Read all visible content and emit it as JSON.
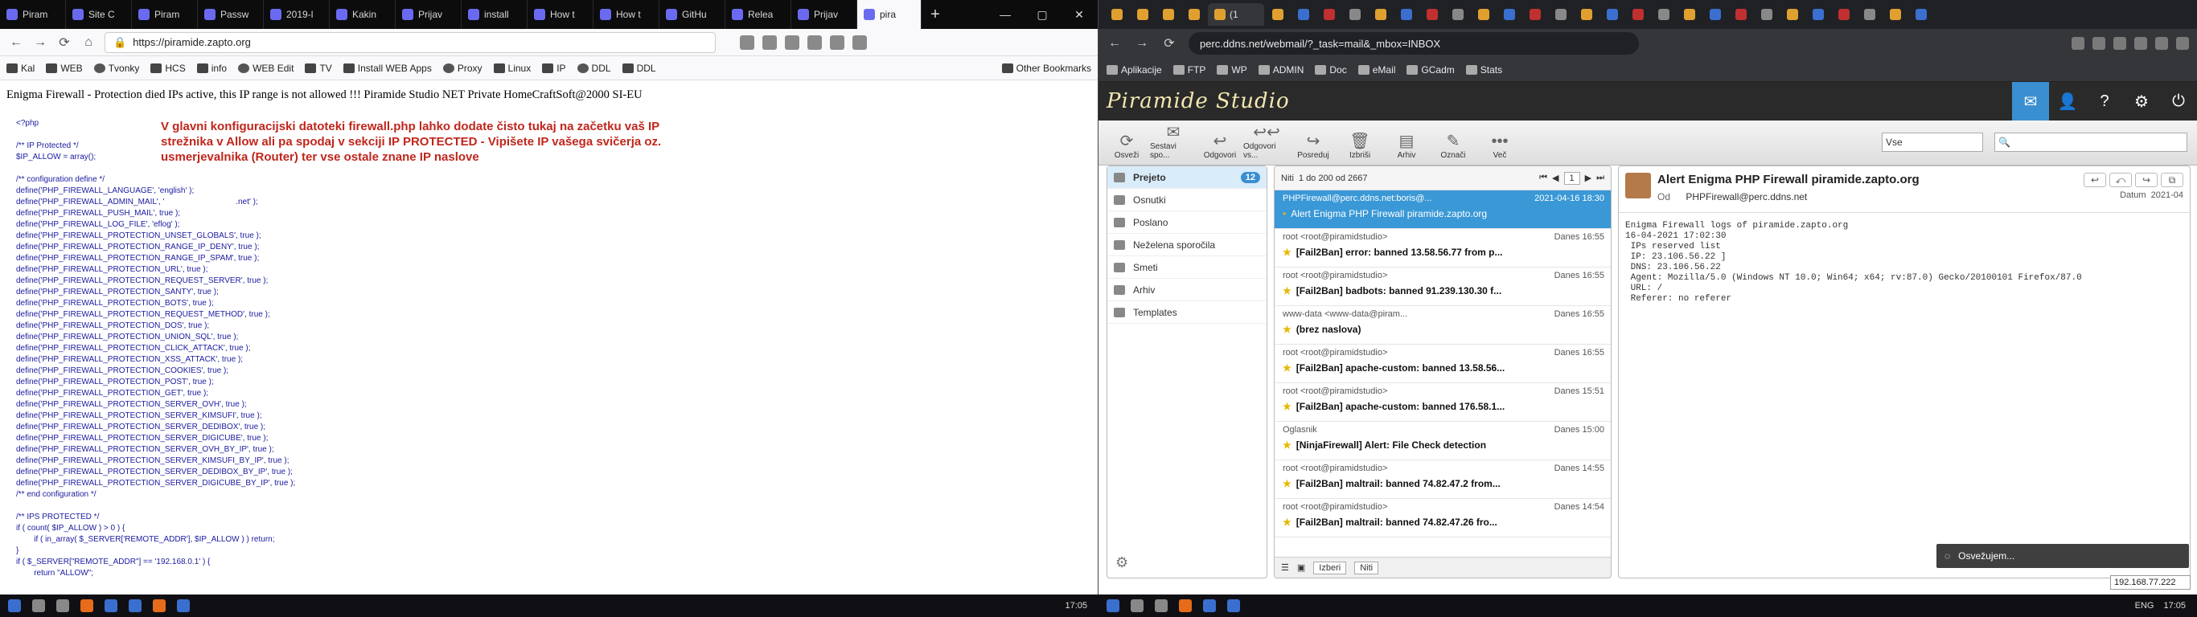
{
  "firefox": {
    "tabs": [
      "Piram",
      "Site C",
      "Piram",
      "Passw",
      "2019-l",
      "Kakin",
      "Prijav",
      "install",
      "How t",
      "How t",
      "GitHu",
      "Relea",
      "Prijav",
      "pira"
    ],
    "url": "https://piramide.zapto.org",
    "bookmarks": [
      "Kal",
      "WEB",
      "Tvonky",
      "HCS",
      "info",
      "WEB Edit",
      "TV",
      "Install WEB Apps",
      "Proxy",
      "Linux",
      "IP",
      "DDL",
      "DDL",
      "Other Bookmarks"
    ],
    "page": {
      "headline": "Enigma Firewall - Protection died IPs active, this IP range is not allowed !!! Piramide Studio NET Private HomeCraftSoft@2000 SI-EU",
      "notice": "V glavni konfiguracijski datoteki firewall.php lahko dodate čisto tukaj na začetku vaš IP strežnika v Allow ali pa spodaj v sekciji IP PROTECTED - Vipišete IP vašega svičerja oz. usmerjevalnika (Router) ter vse ostale znane IP naslove",
      "code": "<?php\n\n/** IP Protected */\n$IP_ALLOW = array();\n\n/** configuration define */\ndefine('PHP_FIREWALL_LANGUAGE', 'english' );\ndefine('PHP_FIREWALL_ADMIN_MAIL', '                                .net' );\ndefine('PHP_FIREWALL_PUSH_MAIL', true );\ndefine('PHP_FIREWALL_LOG_FILE', 'eflog' );\ndefine('PHP_FIREWALL_PROTECTION_UNSET_GLOBALS', true );\ndefine('PHP_FIREWALL_PROTECTION_RANGE_IP_DENY', true );\ndefine('PHP_FIREWALL_PROTECTION_RANGE_IP_SPAM', true );\ndefine('PHP_FIREWALL_PROTECTION_URL', true );\ndefine('PHP_FIREWALL_PROTECTION_REQUEST_SERVER', true );\ndefine('PHP_FIREWALL_PROTECTION_SANTY', true );\ndefine('PHP_FIREWALL_PROTECTION_BOTS', true );\ndefine('PHP_FIREWALL_PROTECTION_REQUEST_METHOD', true );\ndefine('PHP_FIREWALL_PROTECTION_DOS', true );\ndefine('PHP_FIREWALL_PROTECTION_UNION_SQL', true );\ndefine('PHP_FIREWALL_PROTECTION_CLICK_ATTACK', true );\ndefine('PHP_FIREWALL_PROTECTION_XSS_ATTACK', true );\ndefine('PHP_FIREWALL_PROTECTION_COOKIES', true );\ndefine('PHP_FIREWALL_PROTECTION_POST', true );\ndefine('PHP_FIREWALL_PROTECTION_GET', true );\ndefine('PHP_FIREWALL_PROTECTION_SERVER_OVH', true );\ndefine('PHP_FIREWALL_PROTECTION_SERVER_KIMSUFI', true );\ndefine('PHP_FIREWALL_PROTECTION_SERVER_DEDIBOX', true );\ndefine('PHP_FIREWALL_PROTECTION_SERVER_DIGICUBE', true );\ndefine('PHP_FIREWALL_PROTECTION_SERVER_OVH_BY_IP', true );\ndefine('PHP_FIREWALL_PROTECTION_SERVER_KIMSUFI_BY_IP', true );\ndefine('PHP_FIREWALL_PROTECTION_SERVER_DEDIBOX_BY_IP', true );\ndefine('PHP_FIREWALL_PROTECTION_SERVER_DIGICUBE_BY_IP', true );\n/** end configuration */\n\n/** IPS PROTECTED */\nif ( count( $IP_ALLOW ) > 0 ) {\n        if ( in_array( $_SERVER['REMOTE_ADDR'], $IP_ALLOW ) ) return;\n}\nif ( $_SERVER[\"REMOTE_ADDR\"] == '192.168.0.1' ) {\n        return \"ALLOW\";"
    }
  },
  "chrome": {
    "active_tab": "(1",
    "url": "perc.ddns.net/webmail/?_task=mail&_mbox=INBOX",
    "bookmarks": [
      "Aplikacije",
      "FTP",
      "WP",
      "ADMIN",
      "Doc",
      "eMail",
      "GCadm",
      "Stats"
    ],
    "logo": "Piramide Studio",
    "toolbar": [
      "Osveži",
      "Sestavi spo...",
      "Odgovori",
      "Odgovori vs...",
      "Posreduj",
      "Izbriši",
      "Arhiv",
      "Označi",
      "Več"
    ],
    "filter": "Vse",
    "folders": [
      {
        "name": "Prejeto",
        "count": "12",
        "selected": true
      },
      {
        "name": "Osnutki"
      },
      {
        "name": "Poslano"
      },
      {
        "name": "Neželena sporočila"
      },
      {
        "name": "Smeti"
      },
      {
        "name": "Arhiv"
      },
      {
        "name": "Templates"
      }
    ],
    "threads_label": "Niti",
    "range": "1 do 200 od 2667",
    "page_num": "1",
    "messages": [
      {
        "from": "PHPFirewall@perc.ddns.net:boris@...",
        "date": "2021-04-16 18:30",
        "subject": "Alert Enigma PHP Firewall piramide.zapto.org",
        "selected": true
      },
      {
        "from": "root <root@piramidstudio>",
        "date": "Danes 16:55",
        "subject": "[Fail2Ban] error: banned 13.58.56.77 from p..."
      },
      {
        "from": "root <root@piramidstudio>",
        "date": "Danes 16:55",
        "subject": "[Fail2Ban] badbots: banned 91.239.130.30 f..."
      },
      {
        "from": "www-data <www-data@piram...",
        "date": "Danes 16:55",
        "subject": "(brez naslova)"
      },
      {
        "from": "root <root@piramidstudio>",
        "date": "Danes 16:55",
        "subject": "[Fail2Ban] apache-custom: banned 13.58.56..."
      },
      {
        "from": "root <root@piramidstudio>",
        "date": "Danes 15:51",
        "subject": "[Fail2Ban] apache-custom: banned 176.58.1..."
      },
      {
        "from": "Oglasnik",
        "date": "Danes 15:00",
        "subject": "[NinjaFirewall] Alert: File Check detection"
      },
      {
        "from": "root <root@piramidstudio>",
        "date": "Danes 14:55",
        "subject": "[Fail2Ban] maltrail: banned 74.82.47.2 from..."
      },
      {
        "from": "root <root@piramidstudio>",
        "date": "Danes 14:54",
        "subject": "[Fail2Ban] maltrail: banned 74.82.47.26 fro..."
      }
    ],
    "list_footer": {
      "select": "Izberi",
      "threads": "Niti"
    },
    "view": {
      "subject": "Alert Enigma PHP Firewall piramide.zapto.org",
      "from_label": "Od",
      "from": "PHPFirewall@perc.ddns.net",
      "date_label": "Datum",
      "date": "2021-04",
      "body": "Enigma Firewall logs of piramide.zapto.org\n16-04-2021 17:02:30\n IPs reserved list\n IP: 23.106.56.22 ]\n DNS: 23.106.56.22\n Agent: Mozilla/5.0 (Windows NT 10.0; Win64; x64; rv:87.0) Gecko/20100101 Firefox/87.0\n URL: /\n Referer: no referer"
    },
    "toast": "Osvežujem...",
    "ip_tooltip": "192.168.77.222"
  },
  "taskbar": {
    "clock_left": "17:05",
    "clock_right": "17:05",
    "lang": "ENG"
  }
}
